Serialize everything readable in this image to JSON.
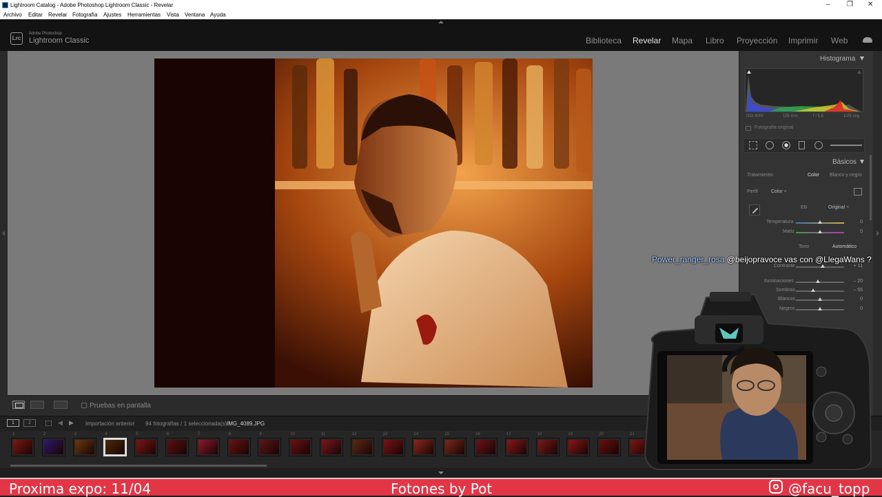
{
  "window": {
    "title": "Lightroom Catalog - Adobe Photoshop Lightroom Classic - Revelar"
  },
  "menu": [
    "Archivo",
    "Editar",
    "Revelar",
    "Fotografía",
    "Ajustes",
    "Herramientas",
    "Vista",
    "Ventana",
    "Ayuda"
  ],
  "brand": {
    "logo": "Lrc",
    "small": "Adobe Photoshop",
    "big": "Lightroom Classic"
  },
  "modules": [
    "Biblioteca",
    "Revelar",
    "Mapa",
    "Libro",
    "Proyección",
    "Imprimir",
    "Web"
  ],
  "active_module": "Revelar",
  "toolbar": {
    "proof_label": "Pruebas en pantalla"
  },
  "filmbar": {
    "view1": "1",
    "view2": "2",
    "source": "Importación anterior",
    "count": "94 fotografías / 1 seleccionada(s) /",
    "filename": "IMG_4089.JPG"
  },
  "histogram": {
    "title": "Histograma",
    "iso": "ISO 4000",
    "focal": "155 mm",
    "aperture": "f / 5,6",
    "shutter": "1/25 seg",
    "original_label": "Fotografía original"
  },
  "basics": {
    "title": "Básicos",
    "treatment_label": "Tratamiento:",
    "treatment_color": "Color",
    "treatment_bw": "Blanco y negro",
    "profile_label": "Perfil",
    "profile_value": "Color ÷",
    "wb_label": "EB",
    "wb_value": "Original ÷",
    "temp_label": "Temperatura",
    "temp_value": "0",
    "tint_label": "Matiz",
    "tint_value": "0",
    "tone_label": "Tono",
    "tone_auto": "Automático",
    "contrast_label": "Contraste",
    "contrast_value": "+ 11",
    "highlights_label": "Iluminaciones",
    "highlights_value": "– 20",
    "shadows_label": "Sombras",
    "shadows_value": "– 55",
    "whites_label": "Blancos",
    "whites_value": "0",
    "blacks_label": "Negros",
    "blacks_value": "0"
  },
  "slider_levels": {
    "temp": 0.5,
    "tint": 0.5,
    "contrast": 0.55,
    "highlights": 0.45,
    "shadows": 0.36,
    "whites": 0.5,
    "blacks": 0.5
  },
  "thumb_numbers": [
    "1",
    "2",
    "3",
    "4",
    "5",
    "6",
    "7",
    "8",
    "9",
    "10",
    "11",
    "12",
    "13",
    "14",
    "15",
    "16",
    "17",
    "18",
    "19",
    "20",
    "21"
  ],
  "chat": {
    "user": "Power_ranger_rosa",
    "message": "@beijopravoce vas con @LlegaWans ?"
  },
  "banner": {
    "left": "Proxima expo: 11/04",
    "center": "Fotones by Pot",
    "right": "@facu_topp"
  }
}
